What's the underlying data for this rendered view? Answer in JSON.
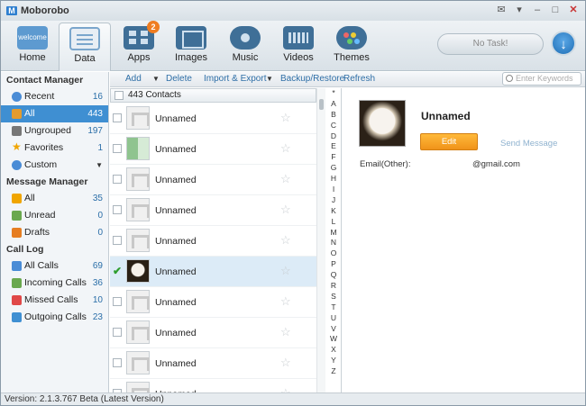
{
  "window": {
    "title": "Moborobo",
    "logo_letter": "M"
  },
  "nav": [
    {
      "label": "Home",
      "icon": "welcome-icon",
      "icon_text": "welcome"
    },
    {
      "label": "Data",
      "icon": "data-icon"
    },
    {
      "label": "Apps",
      "icon": "apps-icon",
      "badge": "2"
    },
    {
      "label": "Images",
      "icon": "images-icon"
    },
    {
      "label": "Music",
      "icon": "music-icon"
    },
    {
      "label": "Videos",
      "icon": "videos-icon"
    },
    {
      "label": "Themes",
      "icon": "themes-icon"
    }
  ],
  "task_label": "No Task!",
  "sidebar": {
    "contact_title": "Contact Manager",
    "contacts": [
      {
        "label": "Recent",
        "count": "16",
        "color": "#4a8cd6"
      },
      {
        "label": "All",
        "count": "443",
        "color": "#e39b2e"
      },
      {
        "label": "Ungrouped",
        "count": "197",
        "color": "#777777"
      },
      {
        "label": "Favorites",
        "count": "1",
        "color": "#f0a500"
      },
      {
        "label": "Custom",
        "color": "#4a8cd6"
      }
    ],
    "message_title": "Message Manager",
    "messages": [
      {
        "label": "All",
        "count": "35",
        "color": "#f0a500"
      },
      {
        "label": "Unread",
        "count": "0",
        "color": "#6aa84f"
      },
      {
        "label": "Drafts",
        "count": "0",
        "color": "#e67e22"
      }
    ],
    "call_title": "Call Log",
    "calls": [
      {
        "label": "All Calls",
        "count": "69",
        "color": "#4a8cd6"
      },
      {
        "label": "Incoming Calls",
        "count": "36",
        "color": "#6aa84f"
      },
      {
        "label": "Missed Calls",
        "count": "10",
        "color": "#e04848"
      },
      {
        "label": "Outgoing Calls",
        "count": "23",
        "color": "#3f8fd2"
      }
    ]
  },
  "actions": {
    "add": "Add",
    "delete": "Delete",
    "import_export": "Import & Export",
    "backup": "Backup/Restore",
    "refresh": "Refresh"
  },
  "search": {
    "placeholder": "Enter Keywords"
  },
  "list": {
    "header": "443 Contacts",
    "rows": [
      {
        "name": "Unnamed",
        "avatar": "default",
        "checked": false
      },
      {
        "name": "Unnamed",
        "avatar": "tiles",
        "checked": false
      },
      {
        "name": "Unnamed",
        "avatar": "default",
        "checked": false
      },
      {
        "name": "Unnamed",
        "avatar": "default",
        "checked": false
      },
      {
        "name": "Unnamed",
        "avatar": "default",
        "checked": false
      },
      {
        "name": "Unnamed",
        "avatar": "photo",
        "checked": true
      },
      {
        "name": "Unnamed",
        "avatar": "default",
        "checked": false
      },
      {
        "name": "Unnamed",
        "avatar": "default",
        "checked": false
      },
      {
        "name": "Unnamed",
        "avatar": "default",
        "checked": false
      },
      {
        "name": "Unnamed",
        "avatar": "default",
        "checked": false
      }
    ]
  },
  "alphabet": [
    "*",
    "A",
    "B",
    "C",
    "D",
    "E",
    "F",
    "G",
    "H",
    "I",
    "J",
    "K",
    "L",
    "M",
    "N",
    "O",
    "P",
    "Q",
    "R",
    "S",
    "T",
    "U",
    "V",
    "W",
    "X",
    "Y",
    "Z"
  ],
  "detail": {
    "name": "Unnamed",
    "edit": "Edit",
    "send": "Send Message",
    "field_label": "Email(Other):",
    "field_value": "@gmail.com"
  },
  "status": "Version: 2.1.3.767 Beta  (Latest Version)"
}
